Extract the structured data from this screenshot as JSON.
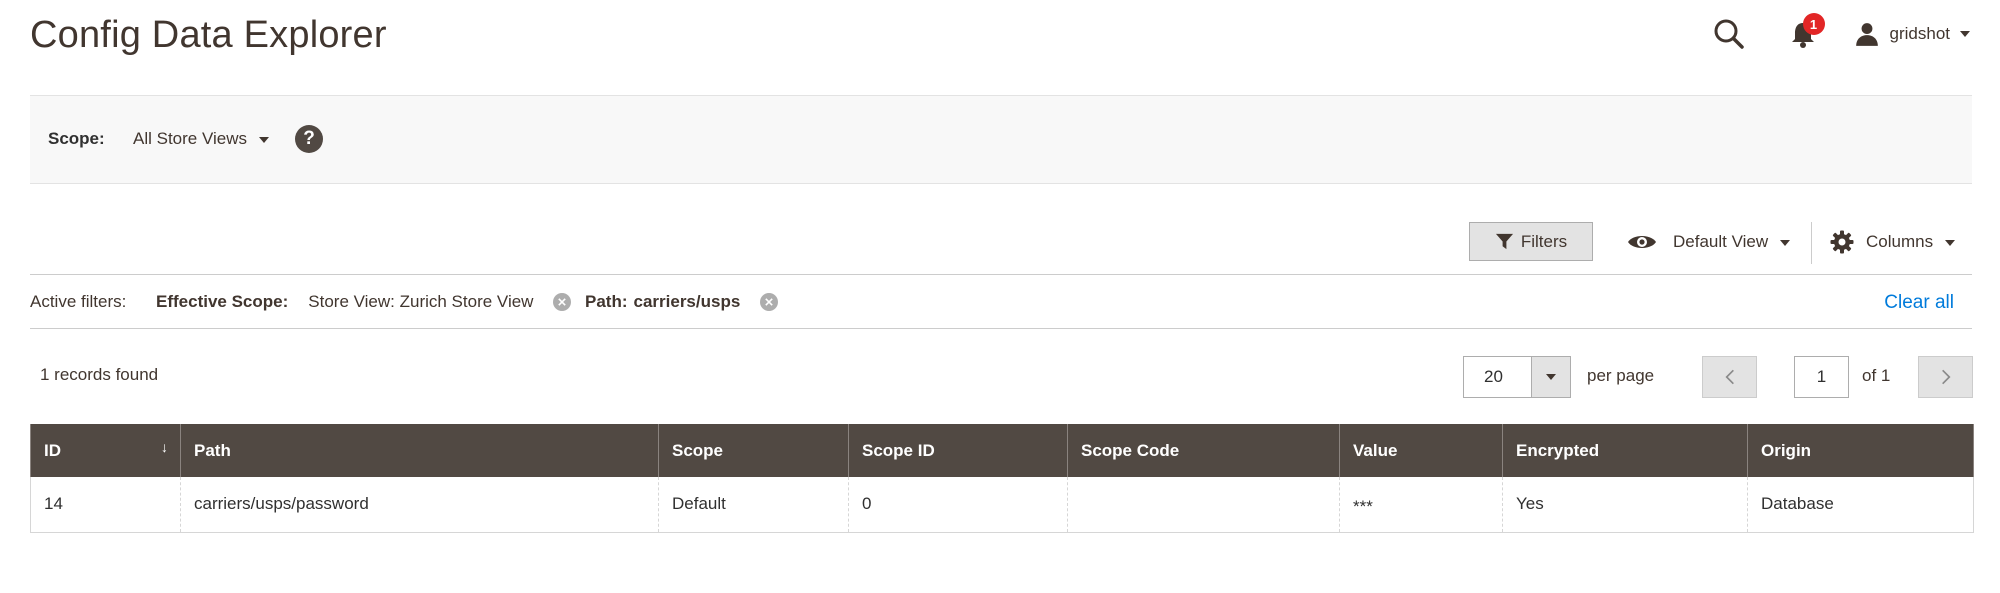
{
  "header": {
    "title": "Config Data Explorer",
    "notifications_count": "1",
    "user_name": "gridshot"
  },
  "scope_bar": {
    "label": "Scope:",
    "selected": "All Store Views",
    "help_glyph": "?"
  },
  "toolbar": {
    "filters_label": "Filters",
    "view_label": "Default View",
    "columns_label": "Columns"
  },
  "active_filters": {
    "title": "Active filters:",
    "items": [
      {
        "label": "Effective Scope:",
        "value": "Store View: Zurich Store View"
      },
      {
        "label": "Path:",
        "value": "carriers/usps"
      }
    ],
    "clear_all": "Clear all"
  },
  "records": {
    "text": "1 records found"
  },
  "pagination": {
    "per_page_value": "20",
    "per_page_label": "per page",
    "current_page": "1",
    "of_label": "of 1"
  },
  "grid": {
    "columns": [
      "ID",
      "Path",
      "Scope",
      "Scope ID",
      "Scope Code",
      "Value",
      "Encrypted",
      "Origin"
    ],
    "sort_indicator": "↓",
    "rows": [
      [
        "14",
        "carriers/usps/password",
        "Default",
        "0",
        "",
        "***",
        "Yes",
        "Database"
      ]
    ]
  },
  "colors": {
    "title": "#41362f",
    "header_bg": "#514943",
    "link": "#007bdb",
    "badge": "#e22626"
  }
}
